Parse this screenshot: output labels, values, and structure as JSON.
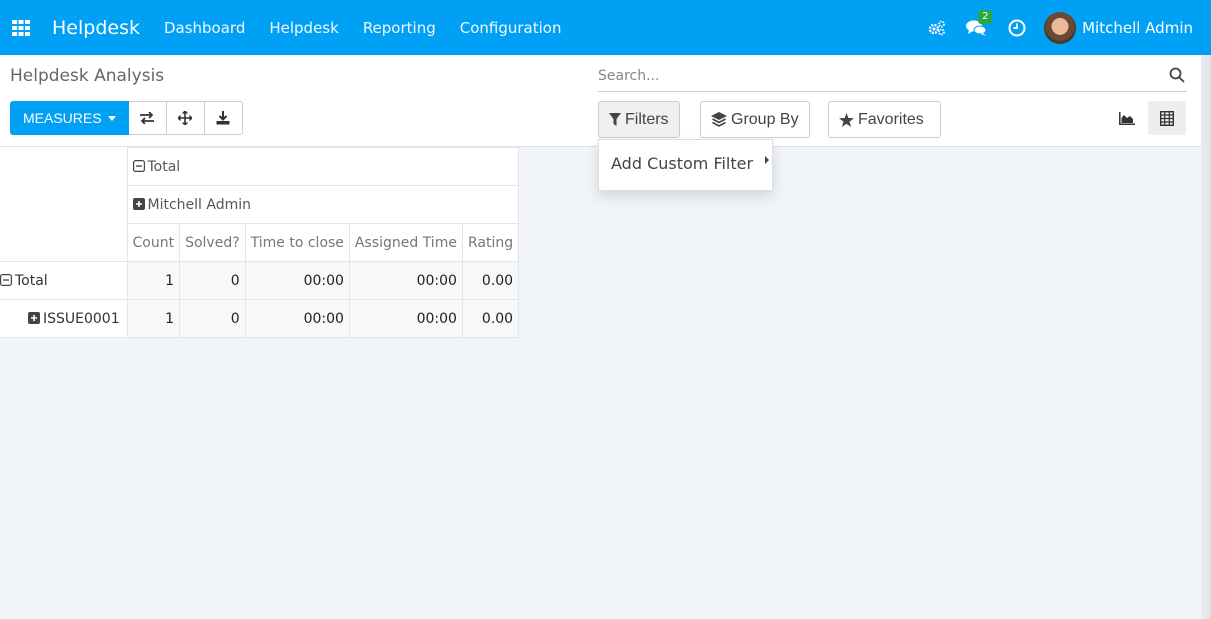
{
  "navbar": {
    "brand": "Helpdesk",
    "menu": [
      "Dashboard",
      "Helpdesk",
      "Reporting",
      "Configuration"
    ],
    "messages_badge": "2",
    "user_name": "Mitchell Admin",
    "bg_color": "#00a0f5"
  },
  "control_panel": {
    "title": "Helpdesk Analysis",
    "measures_label": "MEASURES",
    "search_placeholder": "Search...",
    "filters_label": "Filters",
    "group_by_label": "Group By",
    "favorites_label": "Favorites"
  },
  "filters_dropdown": {
    "items": [
      "Add Custom Filter"
    ]
  },
  "pivot": {
    "col_total_header": "Total",
    "col_group_header": "Mitchell Admin",
    "measures": [
      "Count",
      "Solved?",
      "Time to close",
      "Assigned Time",
      "Rating"
    ],
    "rows": [
      {
        "label": "Total",
        "values": [
          "1",
          "0",
          "00:00",
          "00:00",
          "0.00"
        ]
      },
      {
        "label": "ISSUE0001",
        "values": [
          "1",
          "0",
          "00:00",
          "00:00",
          "0.00"
        ]
      }
    ]
  }
}
